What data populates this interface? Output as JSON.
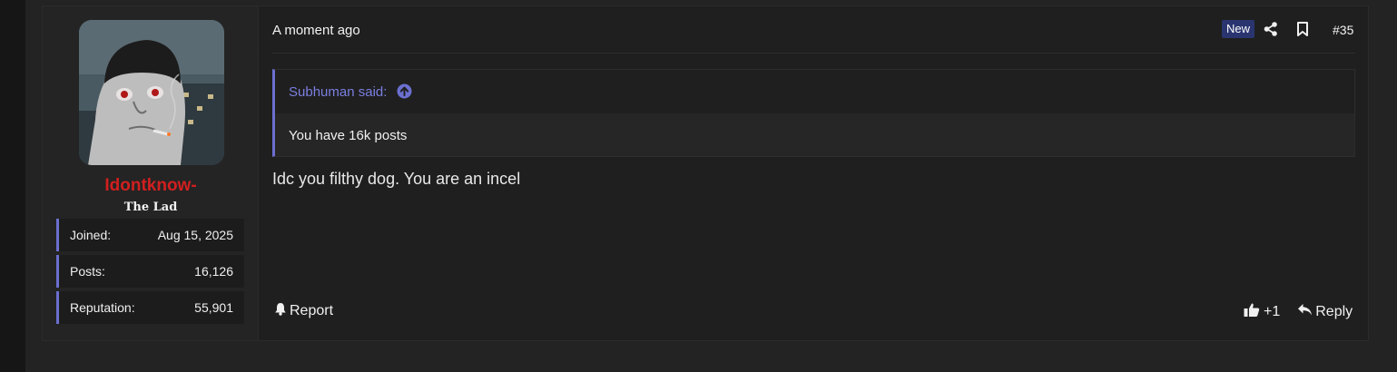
{
  "post": {
    "time": "A moment ago",
    "badge": "New",
    "number": "#35",
    "icons": {
      "share": "share-icon",
      "bookmark": "bookmark-icon"
    },
    "quote": {
      "author_said": "Subhuman said:",
      "text": "You have 16k posts"
    },
    "message": "Idc you filthy dog. You are an incel",
    "footer": {
      "report_label": "Report",
      "like_count": "+1",
      "reply_label": "Reply"
    }
  },
  "user": {
    "name": "Idontknow-",
    "title": "The Lad",
    "stats": [
      {
        "label": "Joined:",
        "value": "Aug 15, 2025"
      },
      {
        "label": "Posts:",
        "value": "16,126"
      },
      {
        "label": "Reputation:",
        "value": "55,901"
      }
    ]
  },
  "colors": {
    "username": "#d21f1f",
    "accent": "#6b6fcf",
    "badge_bg": "#2a3570"
  }
}
